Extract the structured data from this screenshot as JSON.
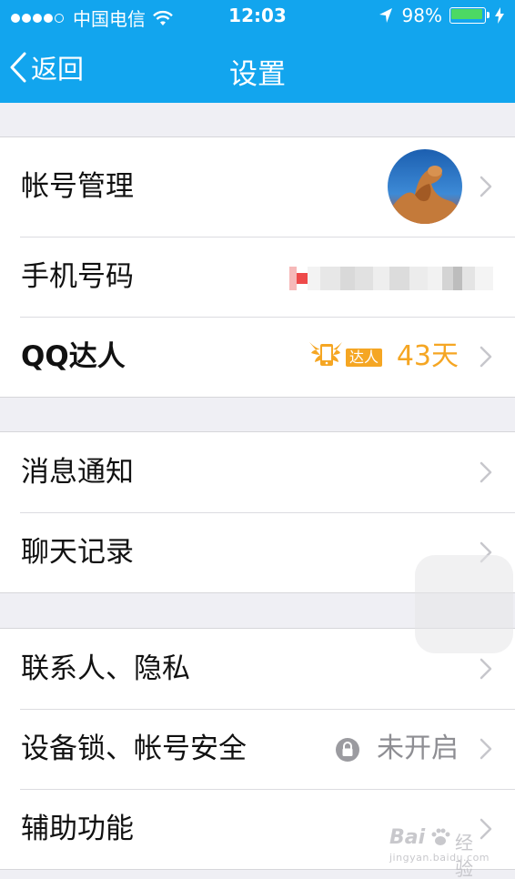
{
  "status_bar": {
    "carrier": "中国电信",
    "time": "12:03",
    "battery": "98%",
    "battery_level": 0.98,
    "signal_bars": 4,
    "signal_max": 5
  },
  "nav": {
    "back_label": "返回",
    "title": "设置"
  },
  "groups": [
    {
      "rows": [
        {
          "label": "帐号管理",
          "accessory": "avatar"
        },
        {
          "label": "手机号码",
          "accessory": "obscured-phone"
        },
        {
          "label": "QQ达人",
          "badge_text": "达人",
          "value": "43天"
        }
      ]
    },
    {
      "rows": [
        {
          "label": "消息通知"
        },
        {
          "label": "聊天记录"
        }
      ]
    },
    {
      "rows": [
        {
          "label": "联系人、隐私"
        },
        {
          "label": "设备锁、帐号安全",
          "value": "未开启",
          "icon": "lock-icon"
        },
        {
          "label": "辅助功能"
        }
      ]
    }
  ],
  "watermark": {
    "logo": "Bai",
    "brand": "经验",
    "url": "jingyan.baidu.com"
  },
  "colors": {
    "header": "#12a5ee",
    "accent_orange": "#f5a623",
    "secondary_text": "#8e8e93",
    "battery": "#4cd964"
  }
}
